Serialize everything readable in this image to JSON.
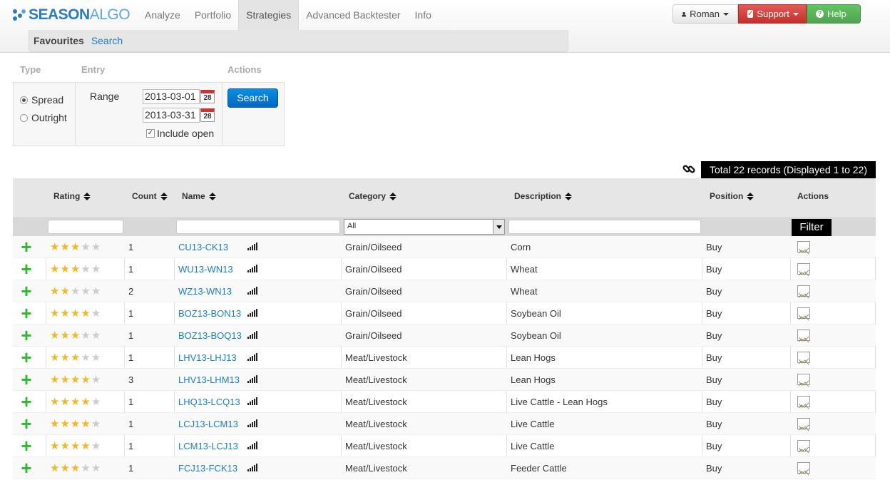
{
  "brand": {
    "part1": "SEASON",
    "part2": "ALGO"
  },
  "nav": {
    "items": [
      "Analyze",
      "Portfolio",
      "Strategies",
      "Advanced Backtester",
      "Info"
    ],
    "active": "Strategies"
  },
  "subnav": {
    "favourites": "Favourites",
    "search": "Search"
  },
  "user_menu": {
    "user": "Roman",
    "support": "Support",
    "help": "Help"
  },
  "form": {
    "labels": {
      "type": "Type",
      "entry": "Entry",
      "actions": "Actions"
    },
    "type_options": [
      "Spread",
      "Outright"
    ],
    "type_selected": "Spread",
    "range_label": "Range",
    "date_from": "2013-03-01",
    "date_to": "2013-03-31",
    "calendar_day": "28",
    "include_open": "Include open",
    "include_open_checked": true,
    "search_button": "Search"
  },
  "total_records": "Total 22 records (Displayed 1 to 22)",
  "table": {
    "headers": {
      "rating": "Rating",
      "count": "Count",
      "name": "Name",
      "category": "Category",
      "description": "Description",
      "position": "Position",
      "actions": "Actions"
    },
    "filters": {
      "category_select": "All",
      "filter_button": "Filter"
    },
    "rows": [
      {
        "rating": 3,
        "count": "1",
        "name": "CU13-CK13",
        "category": "Grain/Oilseed",
        "description": "Corn",
        "position": "Buy"
      },
      {
        "rating": 3,
        "count": "1",
        "name": "WU13-WN13",
        "category": "Grain/Oilseed",
        "description": "Wheat",
        "position": "Buy"
      },
      {
        "rating": 2,
        "count": "2",
        "name": "WZ13-WN13",
        "category": "Grain/Oilseed",
        "description": "Wheat",
        "position": "Buy"
      },
      {
        "rating": 4,
        "count": "1",
        "name": "BOZ13-BON13",
        "category": "Grain/Oilseed",
        "description": "Soybean Oil",
        "position": "Buy"
      },
      {
        "rating": 3,
        "count": "1",
        "name": "BOZ13-BOQ13",
        "category": "Grain/Oilseed",
        "description": "Soybean Oil",
        "position": "Buy"
      },
      {
        "rating": 3,
        "count": "1",
        "name": "LHV13-LHJ13",
        "category": "Meat/Livestock",
        "description": "Lean Hogs",
        "position": "Buy"
      },
      {
        "rating": 3.5,
        "count": "3",
        "name": "LHV13-LHM13",
        "category": "Meat/Livestock",
        "description": "Lean Hogs",
        "position": "Buy"
      },
      {
        "rating": 4,
        "count": "1",
        "name": "LHQ13-LCQ13",
        "category": "Meat/Livestock",
        "description": "Live Cattle - Lean Hogs",
        "position": "Buy"
      },
      {
        "rating": 4,
        "count": "1",
        "name": "LCJ13-LCM13",
        "category": "Meat/Livestock",
        "description": "Live Cattle",
        "position": "Buy"
      },
      {
        "rating": 4,
        "count": "1",
        "name": "LCM13-LCJ13",
        "category": "Meat/Livestock",
        "description": "Live Cattle",
        "position": "Buy"
      },
      {
        "rating": 3,
        "count": "1",
        "name": "FCJ13-FCK13",
        "category": "Meat/Livestock",
        "description": "Feeder Cattle",
        "position": "Buy"
      }
    ]
  },
  "colors": {
    "link": "#1a7ec2",
    "plus": "#2eb82e",
    "star": "#f2b72a",
    "support": "#c4302b",
    "help": "#51a351",
    "search": "#0566c3"
  }
}
